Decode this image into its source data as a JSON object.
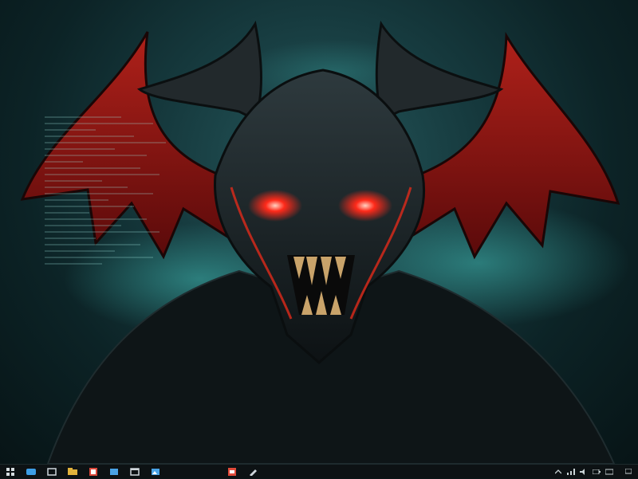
{
  "wallpaper": {
    "subject": "demon-mask",
    "colors": {
      "bg_center": "#25585c",
      "bg_edge": "#071416",
      "mask": "#1a2225",
      "wing": "#8e1414",
      "eyes": "#ff2a1a",
      "mist": "#3fb6b0"
    }
  },
  "taskbar": {
    "left_icons": [
      {
        "name": "start-icon",
        "color": "#d6dde0"
      },
      {
        "name": "edge-icon",
        "color": "#3d9ee6"
      },
      {
        "name": "store-icon",
        "color": "#cfd6db"
      },
      {
        "name": "explorer-icon",
        "color": "#e2b33c"
      },
      {
        "name": "office-icon",
        "color": "#d9473a"
      },
      {
        "name": "app-icon",
        "color": "#4aa3e6"
      },
      {
        "name": "window-icon",
        "color": "#cfd6db"
      },
      {
        "name": "photos-icon",
        "color": "#4aa3e6"
      },
      {
        "name": "app-red-icon",
        "color": "#e04a3a"
      },
      {
        "name": "tool-icon",
        "color": "#cfd6db"
      }
    ],
    "tray_icons": [
      {
        "name": "chevron-up-icon"
      },
      {
        "name": "network-icon"
      },
      {
        "name": "volume-icon"
      },
      {
        "name": "battery-icon"
      },
      {
        "name": "language-icon"
      }
    ],
    "clock": {
      "line1": "",
      "line2": ""
    }
  }
}
